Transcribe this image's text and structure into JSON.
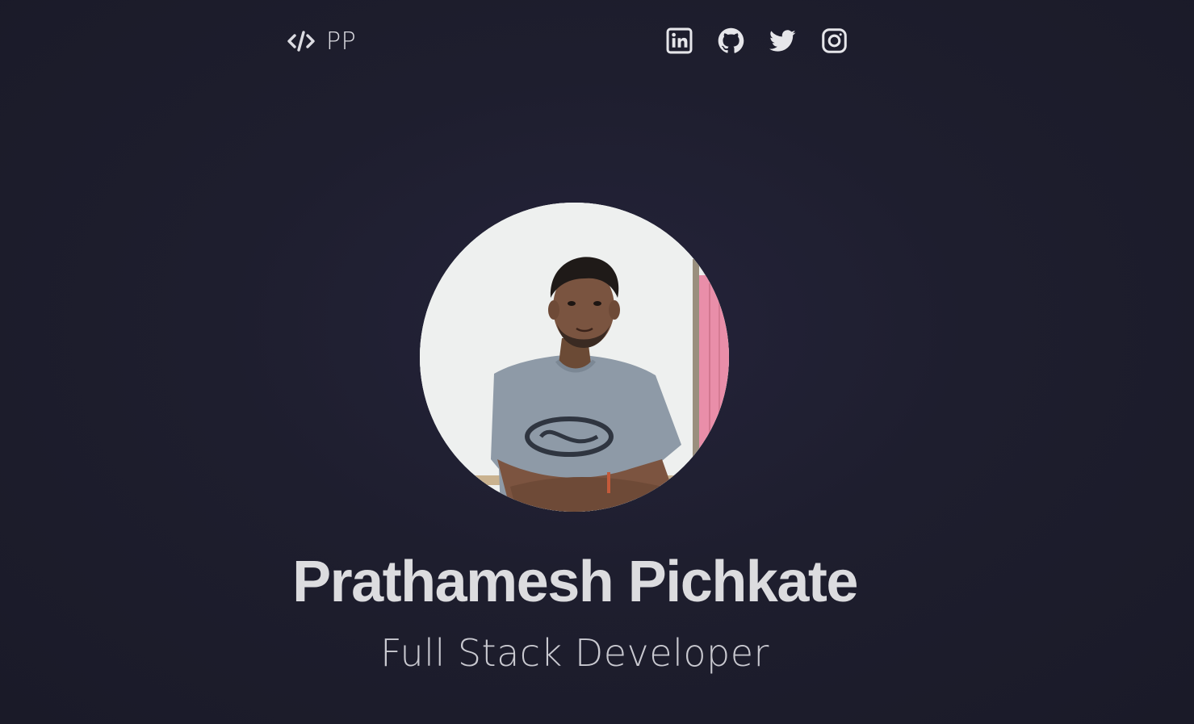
{
  "header": {
    "logo_icon": "code-icon",
    "logo_text": "PP",
    "socials": [
      {
        "name": "LinkedIn",
        "icon": "linkedin-icon"
      },
      {
        "name": "GitHub",
        "icon": "github-icon"
      },
      {
        "name": "Twitter",
        "icon": "twitter-icon"
      },
      {
        "name": "Instagram",
        "icon": "instagram-icon"
      }
    ]
  },
  "hero": {
    "name": "Prathamesh Pichkate",
    "role": "Full Stack Developer"
  },
  "colors": {
    "background": "#1e1e2e",
    "text": "#dcdcdf",
    "icon": "#e6e6ea"
  }
}
